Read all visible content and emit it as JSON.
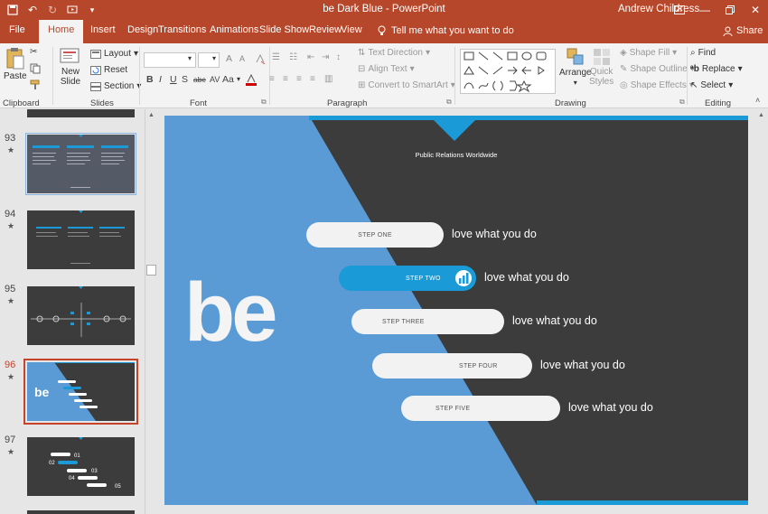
{
  "window": {
    "title": "be Dark Blue  -  PowerPoint",
    "user": "Andrew Childress"
  },
  "tabs": [
    "File",
    "Home",
    "Insert",
    "Design",
    "Transitions",
    "Animations",
    "Slide Show",
    "Review",
    "View"
  ],
  "tell_me": "Tell me what you want to do",
  "share": "Share",
  "ribbon": {
    "clipboard": {
      "paste": "Paste",
      "label": "Clipboard"
    },
    "slides": {
      "new_slide_1": "New",
      "new_slide_2": "Slide",
      "layout": "Layout",
      "reset": "Reset",
      "section": "Section",
      "label": "Slides"
    },
    "font": {
      "label": "Font",
      "bold": "B",
      "italic": "I",
      "underline": "U",
      "strike": "S",
      "shadow": "abc",
      "spacing": "AV",
      "case": "Aa",
      "grow": "A",
      "shrink": "A"
    },
    "paragraph": {
      "label": "Paragraph",
      "text_direction": "Text Direction",
      "align_text": "Align Text",
      "smartart": "Convert to SmartArt"
    },
    "drawing": {
      "label": "Drawing",
      "arrange": "Arrange",
      "quick_1": "Quick",
      "quick_2": "Styles",
      "shape_fill": "Shape Fill",
      "shape_outline": "Shape Outline",
      "shape_effects": "Shape Effects"
    },
    "editing": {
      "label": "Editing",
      "find": "Find",
      "replace": "Replace",
      "select": "Select"
    }
  },
  "thumbnails": [
    {
      "num": "93",
      "star": "★"
    },
    {
      "num": "94",
      "star": "★"
    },
    {
      "num": "95",
      "star": "★"
    },
    {
      "num": "96",
      "star": "★"
    },
    {
      "num": "97",
      "star": "★"
    }
  ],
  "thumb97": {
    "n1": "01",
    "n2": "02",
    "n3": "03",
    "n4": "04",
    "n5": "05"
  },
  "slide": {
    "header": "Public Relations Worldwide",
    "logo": "be",
    "steps": [
      {
        "label": "STEP ONE",
        "text": "love what you do"
      },
      {
        "label": "STEP TWO",
        "text": "love what you do"
      },
      {
        "label": "STEP THREE",
        "text": "love what you do"
      },
      {
        "label": "STEP FOUR",
        "text": "love what you do"
      },
      {
        "label": "STEP FIVE",
        "text": "love what you do"
      }
    ]
  },
  "colors": {
    "brand": "#b7472a",
    "slide_blue": "#5b9bd5",
    "slide_dark": "#3c3c3c",
    "accent": "#1a9ad6"
  }
}
